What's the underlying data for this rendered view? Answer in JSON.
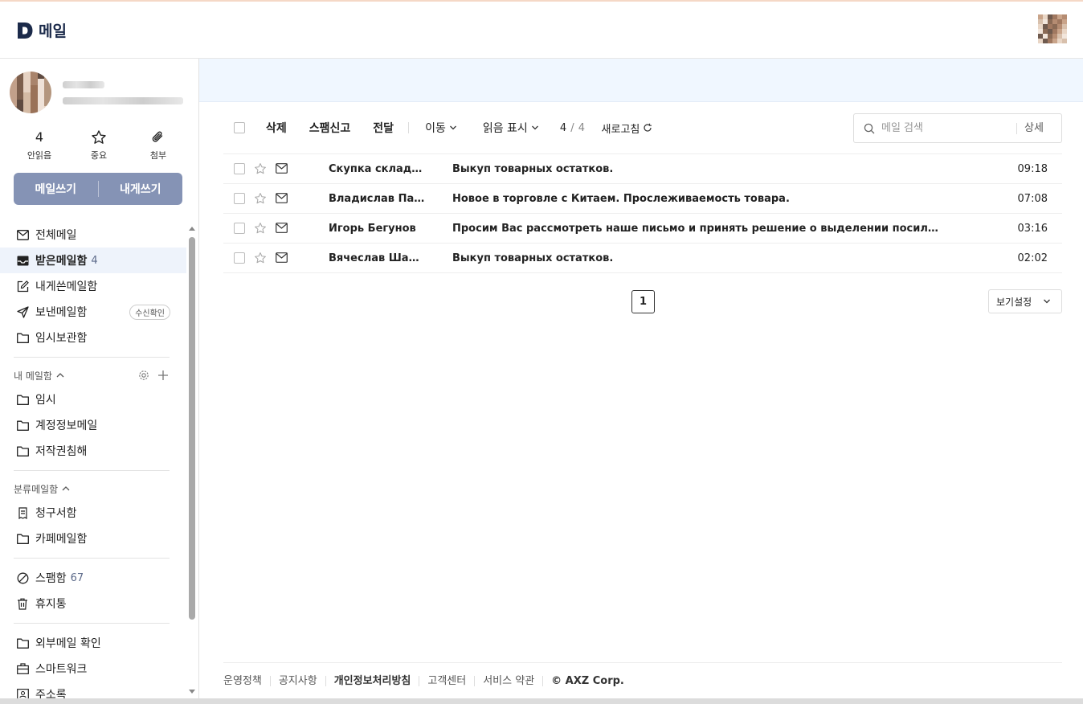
{
  "header": {
    "app_name": "메일"
  },
  "profile": {
    "blurred": true
  },
  "stats": [
    {
      "value": "4",
      "label": "안읽음",
      "icon": "unread-count"
    },
    {
      "value": "",
      "label": "중요",
      "icon": "star-icon"
    },
    {
      "value": "",
      "label": "첨부",
      "icon": "paperclip-icon"
    }
  ],
  "compose": {
    "write_label": "메일쓰기",
    "self_label": "내게쓰기"
  },
  "nav": {
    "all": "전체메일",
    "inbox": "받은메일함",
    "inbox_count": "4",
    "to_me": "내게쓴메일함",
    "sent": "보낸메일함",
    "sent_badge": "수신확인",
    "drafts": "임시보관함"
  },
  "my_folders": {
    "title": "내 메일함",
    "items": [
      "임시",
      "계정정보메일",
      "저작권침해"
    ]
  },
  "category_folders": {
    "title": "분류메일함",
    "items": [
      "청구서함",
      "카페메일함"
    ]
  },
  "misc": {
    "spam": "스팸함",
    "spam_count": "67",
    "trash": "휴지통",
    "external": "외부메일 확인",
    "smartwork": "스마트워크",
    "contacts": "주소록"
  },
  "toolbar": {
    "delete": "삭제",
    "spam": "스팸신고",
    "forward": "전달",
    "move": "이동",
    "read_mark": "읽음 표시",
    "count_current": "4",
    "count_total": "4",
    "refresh": "새로고침"
  },
  "search": {
    "placeholder": "메일 검색",
    "detail": "상세"
  },
  "mails": [
    {
      "sender": "Скупка складс...",
      "subject": "Выкуп товарных остатков.",
      "time": "09:18"
    },
    {
      "sender": "Владислав Па...",
      "subject": "Новое в торговле с Китаем. Прослеживаемость товара.",
      "time": "07:08"
    },
    {
      "sender": "Игорь Бегунов",
      "subject": "Просим Вас рассмотреть наше письмо и принять решение о выделении посильной...",
      "time": "03:16"
    },
    {
      "sender": "Вячеслав Шас...",
      "subject": "Выкуп товарных остатков.",
      "time": "02:02"
    }
  ],
  "pagination": {
    "current": "1"
  },
  "view_settings": "보기설정",
  "footer": {
    "links": [
      "운영정책",
      "공지사항",
      "개인정보처리방침",
      "고객센터",
      "서비스 약관"
    ],
    "copyright": "© AXZ Corp."
  },
  "colors": {
    "accent": "#8593b5",
    "brand": "#1b2a4a",
    "banner": "#f0f7ff"
  }
}
